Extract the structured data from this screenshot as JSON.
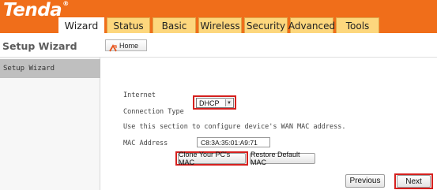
{
  "brand": {
    "logo_text": "Tenda",
    "trademark": "®"
  },
  "tabs": [
    {
      "label": "Wizard",
      "active": true
    },
    {
      "label": "Status",
      "active": false
    },
    {
      "label": "Basic",
      "active": false
    },
    {
      "label": "Wireless",
      "active": false
    },
    {
      "label": "Security",
      "active": false
    },
    {
      "label": "Advanced",
      "active": false
    },
    {
      "label": "Tools",
      "active": false
    }
  ],
  "subheader": {
    "title": "Setup Wizard",
    "home_label": "Home"
  },
  "sidebar": {
    "items": [
      {
        "label": "Setup Wizard",
        "selected": true
      }
    ]
  },
  "form": {
    "internet_label_line1": "Internet",
    "internet_label_line2": "Connection Type",
    "connection_type": "DHCP",
    "mac_help_text": "Use this section to configure device's WAN MAC address.",
    "mac_label": "MAC Address",
    "mac_value": "C8:3A:35:01:A9:71",
    "clone_label": "Clone Your PC's MAC",
    "restore_label": "Restore Default MAC"
  },
  "nav": {
    "previous_label": "Previous",
    "next_label": "Next"
  },
  "colors": {
    "header_orange": "#f06e1a",
    "tab_yellow": "#fdd77d",
    "highlight_red": "#d5201e"
  }
}
